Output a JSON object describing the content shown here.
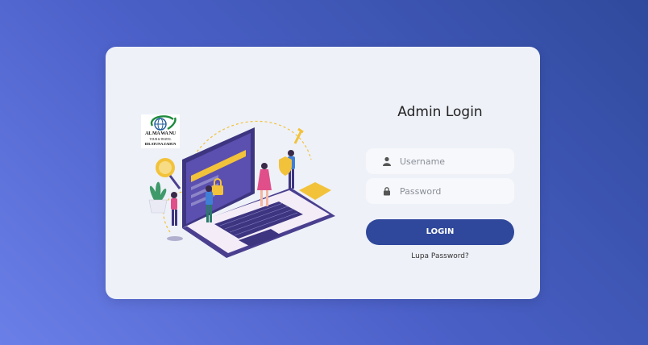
{
  "background": {
    "gradient_from": "#6b7fe8",
    "gradient_to": "#2f4a9c"
  },
  "card": {
    "background": "#eef1f8"
  },
  "logo": {
    "line1": "AL MA WA NU",
    "line2": "TOUR & TRAVEL",
    "line3": "IDLATUNA ZADUN",
    "icon": "globe-icon"
  },
  "illustration": {
    "icon": "laptop-security-illustration"
  },
  "form": {
    "title": "Admin Login",
    "username": {
      "placeholder": "Username",
      "value": "",
      "icon": "user-icon"
    },
    "password": {
      "placeholder": "Password",
      "value": "",
      "icon": "lock-icon"
    },
    "login_label": "LOGIN",
    "forgot_label": "Lupa Password?",
    "button_color": "#2f489b"
  }
}
